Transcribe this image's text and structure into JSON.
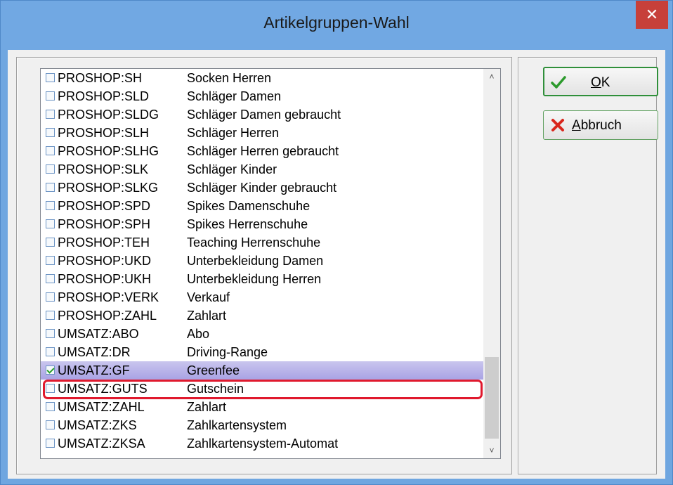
{
  "window": {
    "title": "Artikelgruppen-Wahl",
    "close_label": "✕"
  },
  "list": {
    "items": [
      {
        "code": "PROSHOP:SH",
        "desc": "Socken Herren",
        "checked": false
      },
      {
        "code": "PROSHOP:SLD",
        "desc": "Schläger Damen",
        "checked": false
      },
      {
        "code": "PROSHOP:SLDG",
        "desc": "Schläger Damen gebraucht",
        "checked": false
      },
      {
        "code": "PROSHOP:SLH",
        "desc": "Schläger Herren",
        "checked": false
      },
      {
        "code": "PROSHOP:SLHG",
        "desc": "Schläger Herren gebraucht",
        "checked": false
      },
      {
        "code": "PROSHOP:SLK",
        "desc": "Schläger Kinder",
        "checked": false
      },
      {
        "code": "PROSHOP:SLKG",
        "desc": "Schläger Kinder gebraucht",
        "checked": false
      },
      {
        "code": "PROSHOP:SPD",
        "desc": "Spikes Damenschuhe",
        "checked": false
      },
      {
        "code": "PROSHOP:SPH",
        "desc": "Spikes Herrenschuhe",
        "checked": false
      },
      {
        "code": "PROSHOP:TEH",
        "desc": "Teaching Herrenschuhe",
        "checked": false
      },
      {
        "code": "PROSHOP:UKD",
        "desc": "Unterbekleidung Damen",
        "checked": false
      },
      {
        "code": "PROSHOP:UKH",
        "desc": "Unterbekleidung Herren",
        "checked": false
      },
      {
        "code": "PROSHOP:VERK",
        "desc": "Verkauf",
        "checked": false
      },
      {
        "code": "PROSHOP:ZAHL",
        "desc": "Zahlart",
        "checked": false
      },
      {
        "code": "UMSATZ:ABO",
        "desc": "Abo",
        "checked": false
      },
      {
        "code": "UMSATZ:DR",
        "desc": "Driving-Range",
        "checked": false
      },
      {
        "code": "UMSATZ:GF",
        "desc": "Greenfee",
        "checked": true,
        "selected": true
      },
      {
        "code": "UMSATZ:GUTS",
        "desc": "Gutschein",
        "checked": false
      },
      {
        "code": "UMSATZ:ZAHL",
        "desc": "Zahlart",
        "checked": false
      },
      {
        "code": "UMSATZ:ZKS",
        "desc": "Zahlkartensystem",
        "checked": false
      },
      {
        "code": "UMSATZ:ZKSA",
        "desc": "Zahlkartensystem-Automat",
        "checked": false
      }
    ]
  },
  "buttons": {
    "ok": {
      "mnemonic": "O",
      "rest": "K",
      "icon": "checkmark-icon"
    },
    "cancel": {
      "mnemonic": "A",
      "rest": "bbruch",
      "icon": "cross-icon"
    }
  },
  "colors": {
    "accent": "#2f8f3a",
    "highlight_ring": "#e0192d",
    "selection": "#b3adea"
  }
}
